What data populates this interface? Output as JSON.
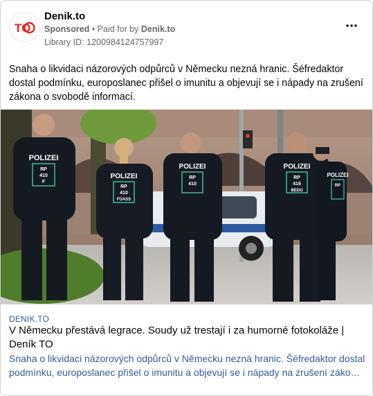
{
  "ad": {
    "page_name": "Denik.to",
    "sponsored_label": "Sponsored",
    "separator": "•",
    "paid_for_label": "Paid for by",
    "paid_for_name": "Denik.to",
    "library_id": "Library ID: 1200984124757997",
    "more_icon": "ellipsis-icon",
    "avatar_text": "TO",
    "brand_color": "#e4231b"
  },
  "post": {
    "text": "Snaha o likvidaci názorových odpůrců v Německu nezná hranic. Šéfredaktor dostal podmínku, europoslanec přišel o imunitu a objevují se i nápady na zrušení zákona o svobodě informací."
  },
  "photo": {
    "vests": [
      {
        "top": "POLIZEI",
        "line1": "RP",
        "line2": "410",
        "line3": "F"
      },
      {
        "top": "POLIZEI",
        "line1": "RP",
        "line2": "410",
        "line3": "FÜASS"
      },
      {
        "top": "POLIZEI",
        "line1": "RP",
        "line2": "410",
        "line3": ""
      },
      {
        "top": "POLIZEI",
        "line1": "RP",
        "line2": "416",
        "line3": "BEDO"
      },
      {
        "top": "POLIZEI",
        "line1": "RP",
        "line2": "",
        "line3": ""
      }
    ]
  },
  "link": {
    "domain": "DENIK.TO",
    "title": "V Německu přestává legrace. Soudy už trestají i za humorné fotokoláže | Deník TO",
    "description": "Snaha o likvidaci názorových odpůrců v Německu nezná hranic. Šéfredaktor dostal podmínku, europoslanec přišel o imunitu a objevují se i nápady na zrušení zákona o svobodě informací."
  }
}
